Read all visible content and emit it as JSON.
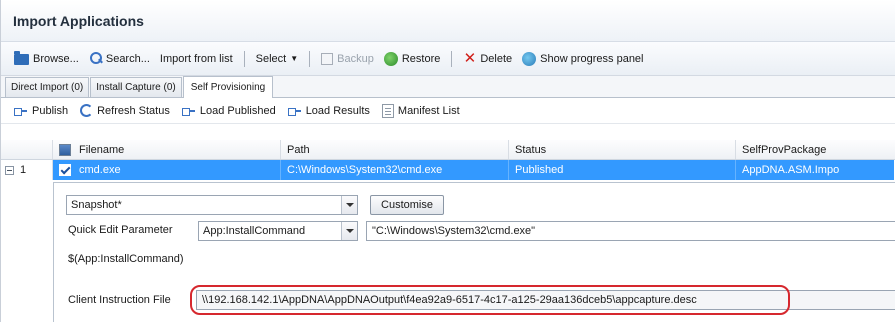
{
  "title": "Import Applications",
  "toolbar": {
    "browse": "Browse...",
    "search": "Search...",
    "import_from_list": "Import from list",
    "select": "Select",
    "backup": "Backup",
    "restore": "Restore",
    "delete": "Delete",
    "show_progress": "Show progress panel"
  },
  "tabs": [
    {
      "label": "Direct Import (0)"
    },
    {
      "label": "Install Capture (0)"
    },
    {
      "label": "Self Provisioning"
    }
  ],
  "subtoolbar": {
    "publish": "Publish",
    "refresh_status": "Refresh Status",
    "load_published": "Load Published",
    "load_results": "Load Results",
    "manifest_list": "Manifest List"
  },
  "grid": {
    "columns": {
      "filename": "Filename",
      "path": "Path",
      "status": "Status",
      "selfprov": "SelfProvPackage"
    },
    "rows": [
      {
        "index": "1",
        "filename": "cmd.exe",
        "path": "C:\\Windows\\System32\\cmd.exe",
        "status": "Published",
        "selfprov": "AppDNA.ASM.Impo"
      }
    ]
  },
  "detail": {
    "mode_value": "Snapshot*",
    "customise": "Customise",
    "quick_edit_label": "Quick Edit Parameter",
    "quick_edit_param": "App:InstallCommand",
    "quick_edit_value": "\"C:\\Windows\\System32\\cmd.exe\"",
    "param_token": "$(App:InstallCommand)",
    "client_instruction_label": "Client Instruction File",
    "client_instruction_value": "\\\\192.168.142.1\\AppDNA\\AppDNAOutput\\f4ea92a9-6517-4c17-a125-29aa136dceb5\\appcapture.desc"
  },
  "colors": {
    "selection": "#3399ff",
    "highlight_ellipse": "#d6282e"
  }
}
